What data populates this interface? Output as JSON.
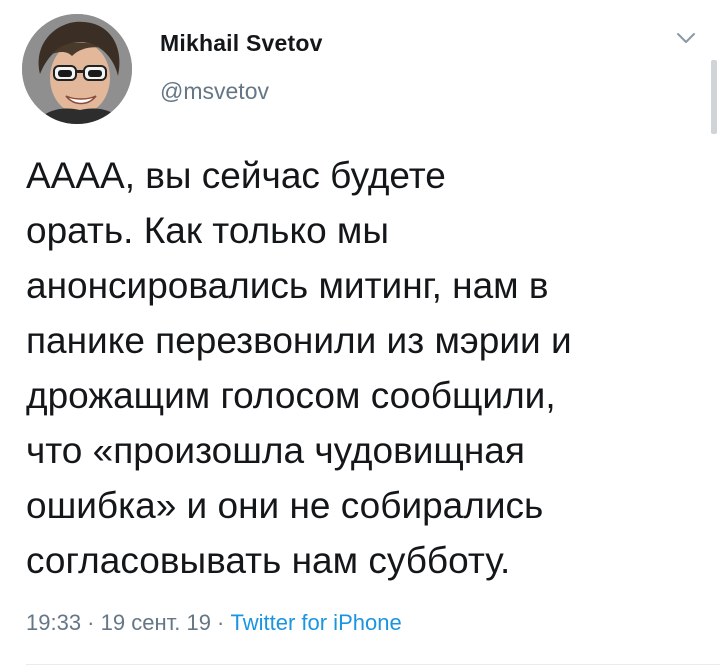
{
  "tweet": {
    "author_name": "Mikhail Svetov",
    "author_handle": "@msvetov",
    "text_lines": [
      "АААА, вы сейчас будете",
      "орать. Как только мы",
      "анонсировались митинг, нам в",
      "панике перезвонили из мэрии и",
      "дрожащим голосом сообщили,",
      "что «произошла чудовищная",
      "ошибка» и они не собирались",
      "согласовывать нам субботу."
    ],
    "time": "19:33",
    "date": "19 сент. 19",
    "source": "Twitter for iPhone",
    "separator": " · "
  },
  "icons": {
    "chevron": "chevron-down-icon",
    "avatar": "avatar"
  },
  "colors": {
    "text": "#14171a",
    "secondary": "#657786",
    "link": "#1b95e0"
  }
}
